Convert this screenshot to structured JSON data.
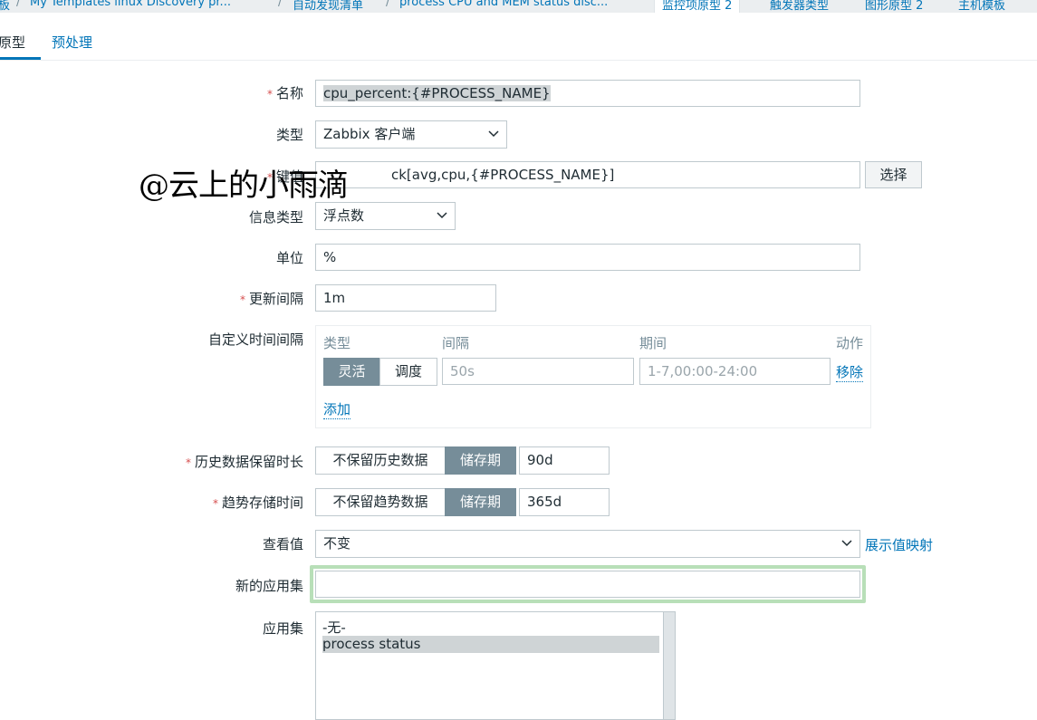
{
  "breadcrumb": {
    "items": [
      "板",
      "My Templates linux Discovery pr...",
      "自动发现清单",
      "process CPU and MEM status disc...",
      "监控项原型 2",
      "触发器类型",
      "图形原型 2",
      "主机模板"
    ]
  },
  "tabs": [
    {
      "label": "原型",
      "active": true
    },
    {
      "label": "预处理",
      "active": false
    }
  ],
  "form": {
    "name": {
      "label": "名称",
      "required": true,
      "value": "cpu_percent:{#PROCESS_NAME}"
    },
    "type": {
      "label": "类型",
      "value": "Zabbix 客户端"
    },
    "key": {
      "label": "键值",
      "required": true,
      "value": "proc.cpu.util[avg,cpu,{#PROCESS_NAME}]",
      "visible_value": "ck[avg,cpu,{#PROCESS_NAME}]",
      "button": "选择"
    },
    "info_type": {
      "label": "信息类型",
      "value": "浮点数"
    },
    "units": {
      "label": "单位",
      "value": "%"
    },
    "update_interval": {
      "label": "更新间隔",
      "required": true,
      "value": "1m"
    },
    "custom_intervals": {
      "label": "自定义时间间隔",
      "headers": {
        "type": "类型",
        "interval": "间隔",
        "period": "期间",
        "action": "动作"
      },
      "row": {
        "flexible": "灵活",
        "scheduling": "调度",
        "interval_placeholder": "50s",
        "period_placeholder": "1-7,00:00-24:00",
        "remove": "移除"
      },
      "add": "添加"
    },
    "history": {
      "label": "历史数据保留时长",
      "required": true,
      "opt_off": "不保留历史数据",
      "opt_on": "储存期",
      "value": "90d"
    },
    "trends": {
      "label": "趋势存储时间",
      "required": true,
      "opt_off": "不保留趋势数据",
      "opt_on": "储存期",
      "value": "365d"
    },
    "valuemap": {
      "label": "查看值",
      "value": "不变",
      "link": "展示值映射"
    },
    "new_application": {
      "label": "新的应用集",
      "value": ""
    },
    "applications": {
      "label": "应用集",
      "options": [
        "-无-",
        "process status"
      ],
      "selected": "process status"
    }
  },
  "watermark": "@云上的小雨滴",
  "colors": {
    "link": "#0275b8",
    "active_segment": "#768d99",
    "focus_border": "#b8dfb8",
    "required": "#d64e4e"
  }
}
